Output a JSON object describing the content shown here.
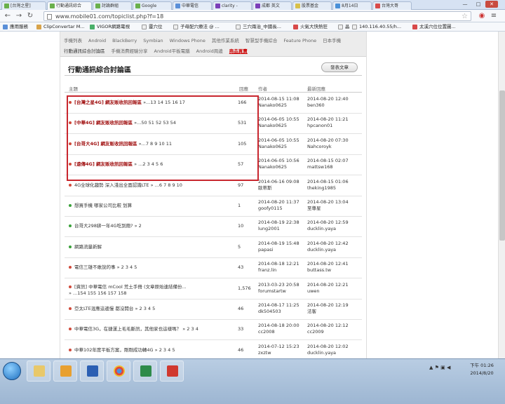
{
  "browser": {
    "tabs": [
      {
        "label": "[台灣之星]"
      },
      {
        "label": "行動通訊綜合"
      },
      {
        "label": "討論群組"
      },
      {
        "label": "Google"
      },
      {
        "label": "中華電信"
      },
      {
        "label": "clarity - "
      },
      {
        "label": "成都 英文"
      },
      {
        "label": "股票基金"
      },
      {
        "label": "8月14日"
      },
      {
        "label": "台灣大哥"
      }
    ],
    "url": "www.mobile01.com/topiclist.php?f=18",
    "bookmarks": [
      "應用服務",
      "ClipConvertar M...",
      "VIGOR網路電視",
      "靈穴位",
      "子母配穴療法 @ ...",
      "三穴兩治_中國長...",
      "火氣大快熱狂",
      "晶",
      "140.116.40.55/h...",
      "太溪穴位位置圖..."
    ]
  },
  "site": {
    "subnav_row1": [
      "手機列表",
      "Android",
      "BlackBerry",
      "Symbian",
      "Windows Phone",
      "其他作業系統",
      "智慧型手機綜合",
      "Feature Phone",
      "日本手機"
    ],
    "subnav_row2": [
      "行動通訊綜合討論區",
      "手機消費經驗分享",
      "Android平板電腦",
      "Android周邊"
    ],
    "subnav_hot": "商品買賣",
    "panel_title": "行動通訊綜合討論區",
    "post_button": "發表文章",
    "columns": {
      "topic": "主題",
      "replies": "回應",
      "author": "作者",
      "latest": "最新回應"
    },
    "topics": [
      {
        "title": "[台灣之星4G] 網友販收訊回報區",
        "pages": "»...13 14 15 16 17",
        "replies": "166",
        "author_date": "2014-08-15 11:08",
        "author": "Nanako0625",
        "last_date": "2014-08-20 12:40",
        "last_user": "ben360",
        "bold": true
      },
      {
        "title": "[中華4G] 網友販收訊回報區",
        "pages": "»...50 51 52 53 54",
        "replies": "531",
        "author_date": "2014-06-05 10:55",
        "author": "Nanako0625",
        "last_date": "2014-08-20 11:21",
        "last_user": "hpcanon01",
        "bold": true
      },
      {
        "title": "[台哥大4G] 網友販收訊回報區",
        "pages": "»...7 8 9 10 11",
        "replies": "105",
        "author_date": "2014-06-05 10:55",
        "author": "Nanako0625",
        "last_date": "2014-08-20 07:30",
        "last_user": "Nahcoroyk",
        "bold": true
      },
      {
        "title": "[遠傳4G] 網友販收訊回報區",
        "pages": "» ...2 3 4 5 6",
        "replies": "57",
        "author_date": "2014-06-05 10:56",
        "author": "Nanako0625",
        "last_date": "2014-08-15 02:07",
        "last_user": "mattsw168",
        "bold": true
      },
      {
        "title": "4G全球化趨勢 深入淺出全面認識LTE",
        "pages": "» ...6 7 8 9 10",
        "replies": "97",
        "author_date": "2014-06-16 09:08",
        "author": "歐蒂斯",
        "last_date": "2014-08-15 01:06",
        "last_user": "theking1985",
        "bold": false
      },
      {
        "title": "想買手機 哪家公司比較 划算",
        "pages": "",
        "replies": "1",
        "author_date": "2014-08-20 11:37",
        "author": "goofy0115",
        "last_date": "2014-08-20 13:04",
        "last_user": "至尊星",
        "bold": false
      },
      {
        "title": "台哥大298綁一年4G吃到飽?",
        "pages": "» 2",
        "replies": "10",
        "author_date": "2014-08-19 22:38",
        "author": "lung2001",
        "last_date": "2014-08-20 12:59",
        "last_user": "ducklin.yaya",
        "bold": false
      },
      {
        "title": "網路流量新解",
        "pages": "",
        "replies": "5",
        "author_date": "2014-08-19 15:48",
        "author": "papasi",
        "last_date": "2014-08-20 12:42",
        "last_user": "ducklin.yaya",
        "bold": false
      },
      {
        "title": "電信三雄不敢說的事",
        "pages": "» 2 3 4 5",
        "replies": "43",
        "author_date": "2014-08-18 12:21",
        "author": "franz.lin",
        "last_date": "2014-08-20 12:41",
        "last_user": "buttass.tw",
        "bold": false
      },
      {
        "title": "[資訊] 中華電信 mCool 荒土手冊 (文章原始連結備份...",
        "pages": "» ...154 155 156 157 158",
        "replies": "1,576",
        "author_date": "2013-03-23 20:58",
        "author": "forumstartw",
        "last_date": "2014-08-20 12:21",
        "last_user": "uwen",
        "bold": false
      },
      {
        "title": "亞太LTE混應這邊慢 都沒開台",
        "pages": "» 2 3 4 5",
        "replies": "46",
        "author_date": "2014-08-17 11:25",
        "author": "dk504503",
        "last_date": "2014-08-20 12:19",
        "last_user": "法客",
        "bold": false
      },
      {
        "title": "中華電信3G，在捷運上毛毛斷訊，其他家也這樣嗎？",
        "pages": "» 2 3 4",
        "replies": "33",
        "author_date": "2014-08-18 20:00",
        "author": "cc2008",
        "last_date": "2014-08-20 12:12",
        "last_user": "cc2009",
        "bold": false
      },
      {
        "title": "中華102年度平板方案，剛剛成功轉4G",
        "pages": "» 2 3 4 5",
        "replies": "46",
        "author_date": "2014-07-12 15:23",
        "author": "zxztw",
        "last_date": "2014-08-20 12:02",
        "last_user": "ducklin.yaya",
        "bold": false
      }
    ]
  },
  "taskbar": {
    "time": "下午 01:26",
    "date": "2014/8/20",
    "apps": [
      "explorer-icon",
      "outlook-icon",
      "word-icon",
      "chrome-icon",
      "excel-icon",
      "pdf-icon"
    ]
  },
  "colors": {
    "highlight_border": "#c8262e",
    "hot_link": "#cc0000",
    "bold_topic": "#a01010",
    "dot_green": "#3aa13a",
    "dot_red": "#d04a3a"
  }
}
